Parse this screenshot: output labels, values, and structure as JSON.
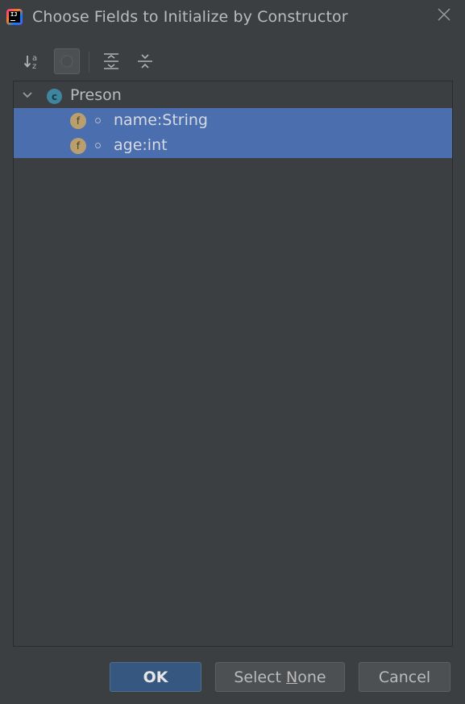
{
  "dialog": {
    "title": "Choose Fields to Initialize by Constructor",
    "app_icon": "intellij-idea-icon",
    "close_icon": "close-icon"
  },
  "toolbar": {
    "buttons": [
      {
        "name": "sort-alphabetically-button",
        "icon": "sort-az-icon"
      },
      {
        "name": "show-classes-button",
        "icon": "circle-toggle-icon",
        "pressed": true
      },
      {
        "name": "expand-all-button",
        "icon": "expand-all-icon"
      },
      {
        "name": "collapse-all-button",
        "icon": "collapse-all-icon"
      }
    ]
  },
  "tree": {
    "class_node": {
      "label": "Preson",
      "icon_letter": "c",
      "expanded": true
    },
    "fields": [
      {
        "label": "name:String",
        "icon_letter": "f",
        "selected": true
      },
      {
        "label": "age:int",
        "icon_letter": "f",
        "selected": true
      }
    ]
  },
  "buttons": {
    "ok": "OK",
    "select_none_prefix": "Select ",
    "select_none_mnemonic": "N",
    "select_none_suffix": "one",
    "cancel": "Cancel"
  },
  "colors": {
    "background": "#3c3f41",
    "selection": "#4b6eaf",
    "default_button": "#365880",
    "field_icon": "#b99f6d",
    "class_icon": "#3e86a0"
  }
}
